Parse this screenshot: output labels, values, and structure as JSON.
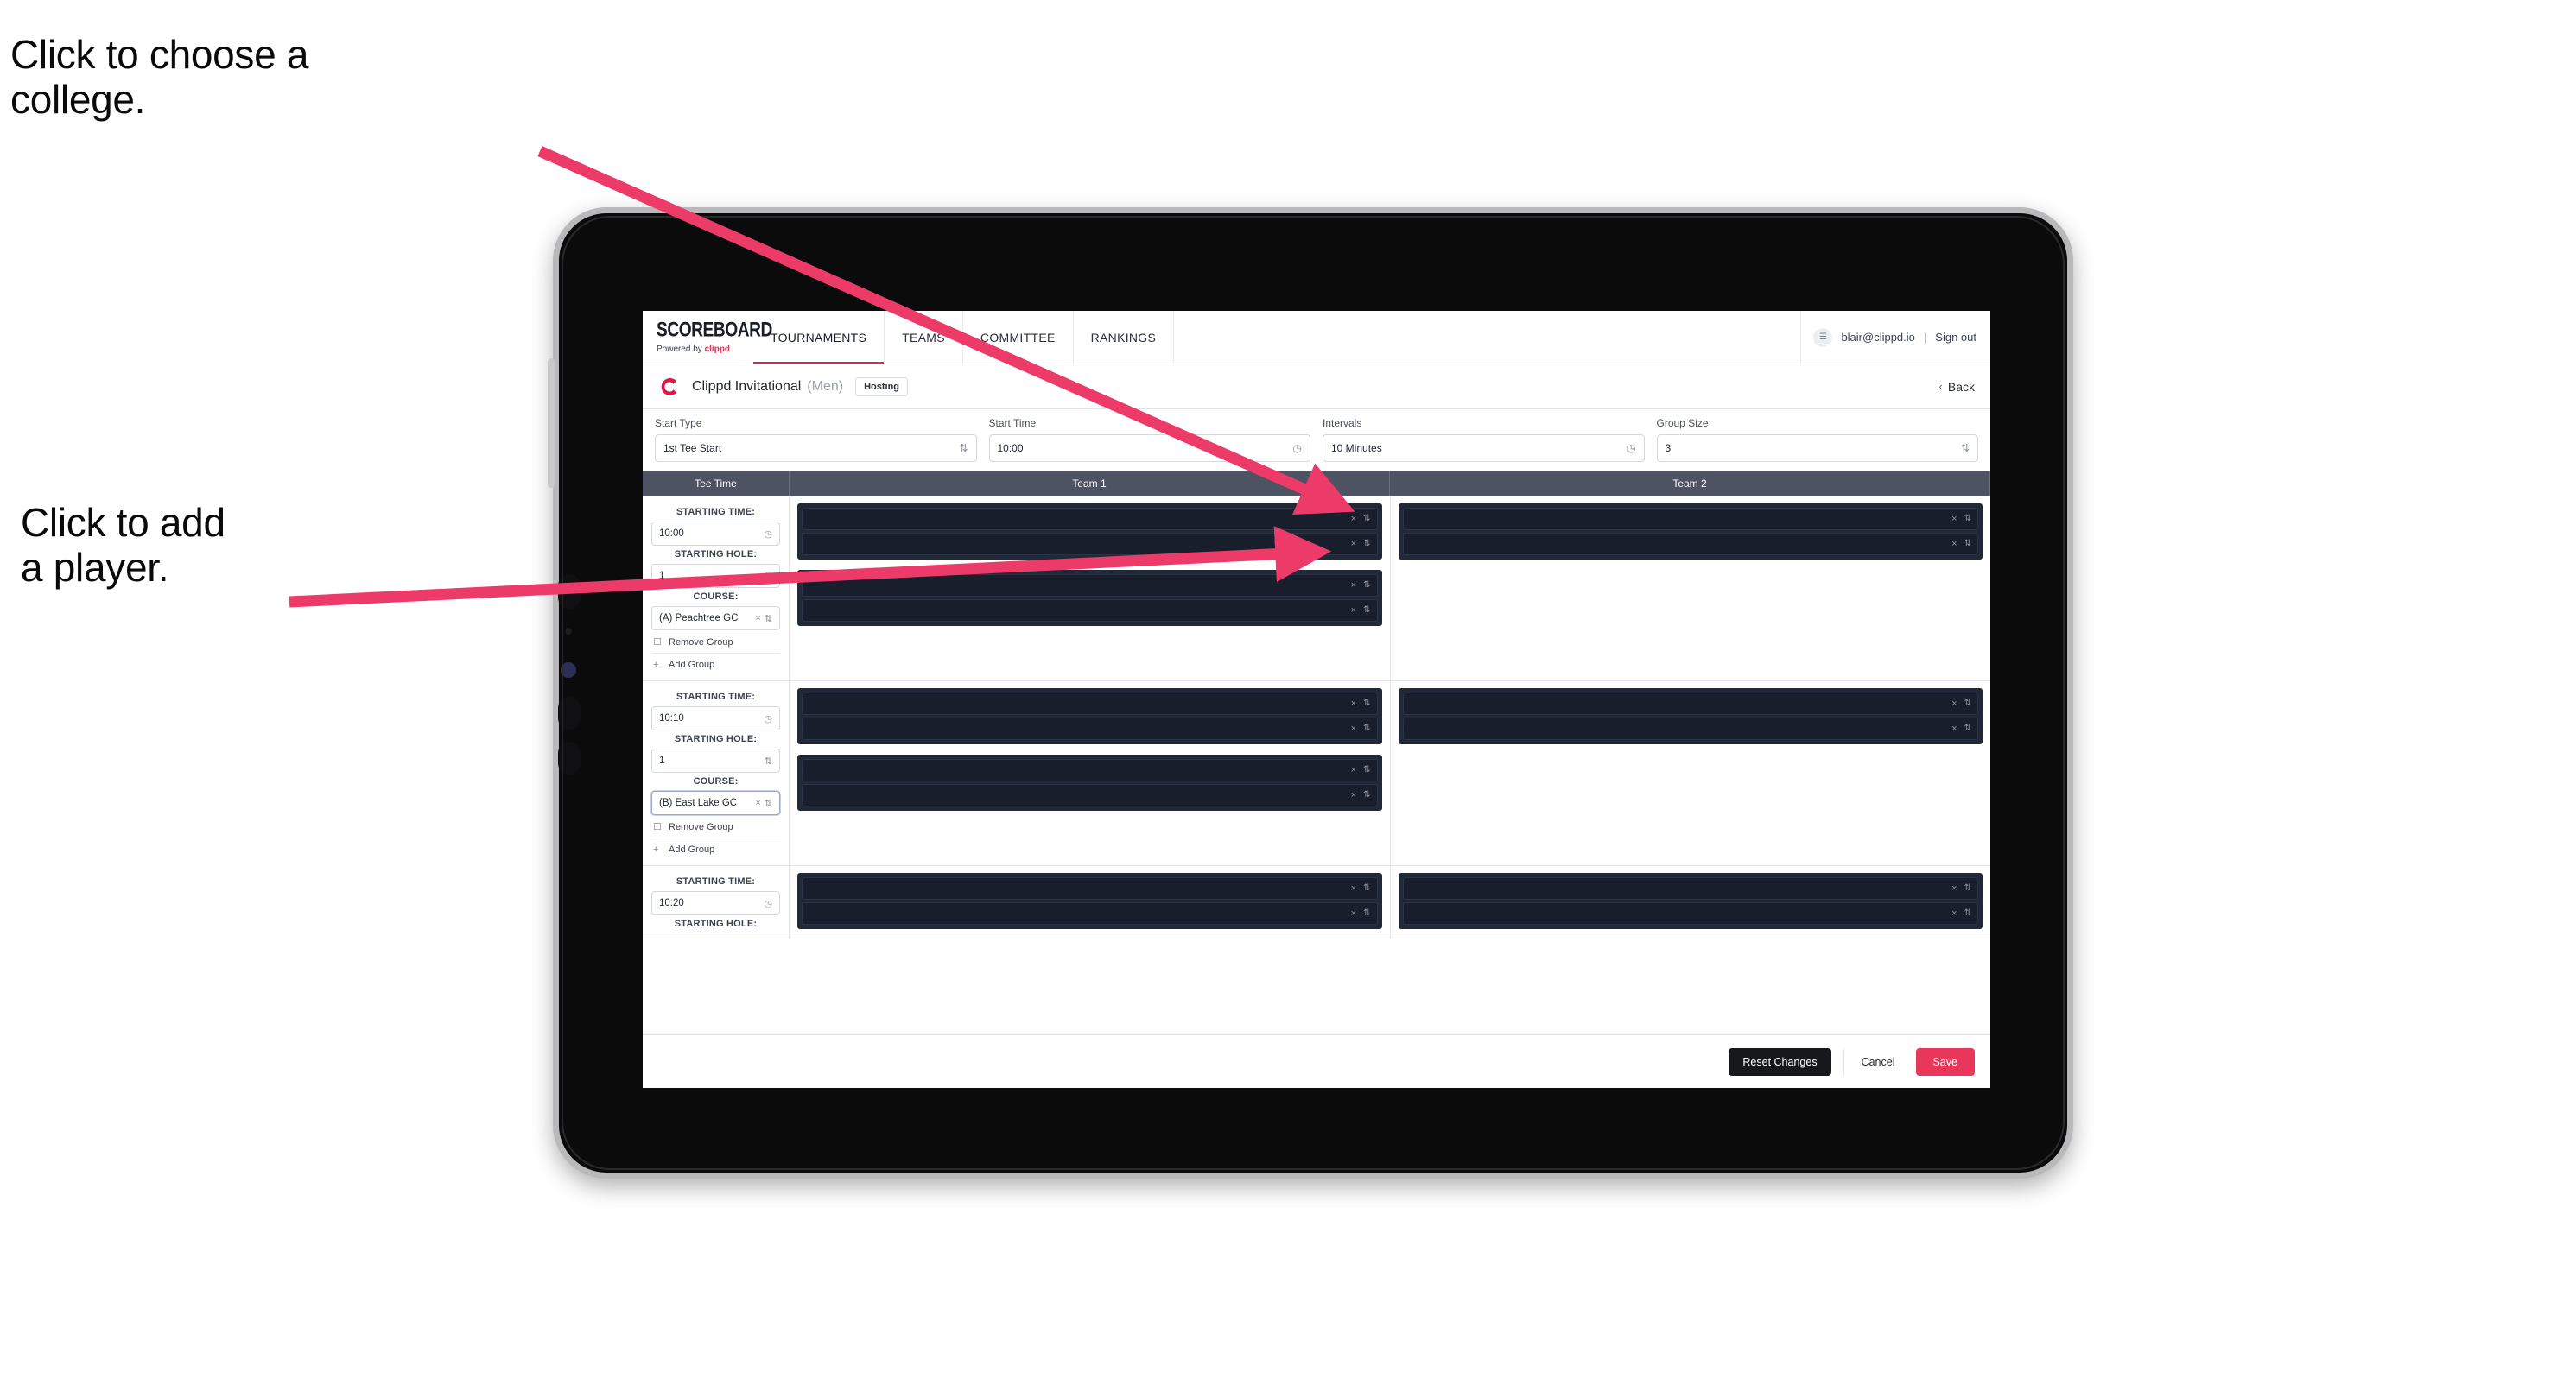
{
  "annotations": {
    "college": "Click to choose a\ncollege.",
    "player": "Click to add\na player."
  },
  "colors": {
    "accent_pink": "#e8375a",
    "annotation_arrow": "#ec3a69",
    "nav_active_underline": "#c8304a",
    "table_header_bg": "#4d5363",
    "slot_panel_bg": "#212838",
    "slot_row_bg": "#181e2b",
    "dark_button": "#17181c"
  },
  "app": {
    "brand": {
      "word": "SCOREBOARD",
      "tagline_prefix": "Powered by ",
      "tagline_brand": "clippd"
    },
    "nav_tabs": [
      {
        "label": "TOURNAMENTS",
        "active": true
      },
      {
        "label": "TEAMS",
        "active": false
      },
      {
        "label": "COMMITTEE",
        "active": false
      },
      {
        "label": "RANKINGS",
        "active": false
      }
    ],
    "user": {
      "avatar_glyph": "☰",
      "email": "blair@clippd.io",
      "divider": "|",
      "sign_out": "Sign out"
    },
    "tournament": {
      "logo_letter": "C",
      "name": "Clippd Invitational",
      "gender": "(Men)",
      "badge": "Hosting",
      "back_label": "Back",
      "back_chevron": "‹"
    },
    "settings": [
      {
        "label": "Start Type",
        "value": "1st Tee Start",
        "adorn": "stepper-icon",
        "adorn_glyph": "⇅"
      },
      {
        "label": "Start Time",
        "value": "10:00",
        "adorn": "clock-icon",
        "adorn_glyph": "◷"
      },
      {
        "label": "Intervals",
        "value": "10 Minutes",
        "adorn": "clock-icon",
        "adorn_glyph": "◷"
      },
      {
        "label": "Group Size",
        "value": "3",
        "adorn": "stepper-icon",
        "adorn_glyph": "⇅"
      }
    ],
    "table": {
      "headers": [
        "Tee Time",
        "Team 1",
        "Team 2"
      ],
      "labels": {
        "starting_time": "STARTING TIME:",
        "starting_hole": "STARTING HOLE:",
        "course": "COURSE:",
        "remove_group": "Remove Group",
        "add_group": "Add Group",
        "remove_icon": "☐",
        "add_icon": "+",
        "clock_glyph": "◷",
        "stepper_glyph": "⇅",
        "clear_glyph": "×"
      },
      "groups": [
        {
          "starting_time": "10:00",
          "starting_hole": "1",
          "course": "(A) Peachtree GC",
          "course_focused": false,
          "team1_panels": [
            2,
            2
          ],
          "team2_panels": [
            2
          ]
        },
        {
          "starting_time": "10:10",
          "starting_hole": "1",
          "course": "(B) East Lake GC",
          "course_focused": true,
          "team1_panels": [
            2,
            2
          ],
          "team2_panels": [
            2
          ]
        },
        {
          "starting_time": "10:20",
          "starting_hole": "",
          "course": "",
          "course_focused": false,
          "team1_panels": [
            2
          ],
          "team2_panels": [
            2
          ],
          "partial": true
        }
      ]
    },
    "footer": {
      "reset": "Reset Changes",
      "cancel": "Cancel",
      "save": "Save"
    }
  }
}
